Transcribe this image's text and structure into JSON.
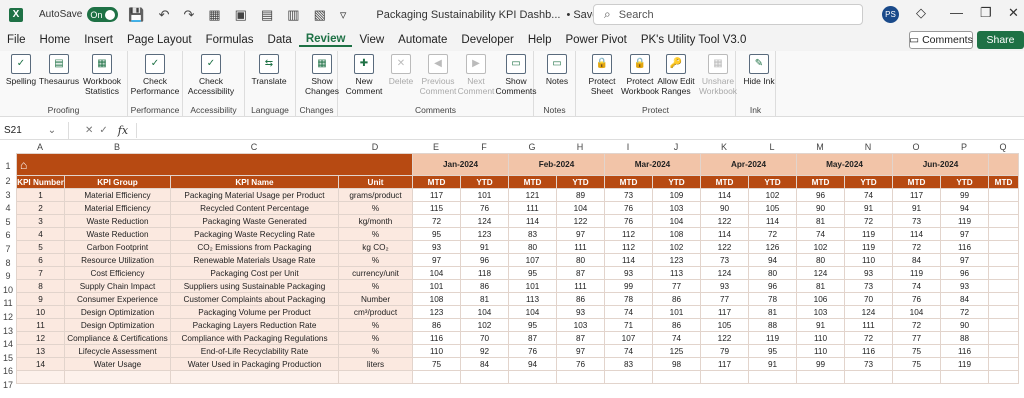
{
  "titlebar": {
    "autosave_label": "AutoSave",
    "autosave_state": "On",
    "doc_title": "Packaging Sustainability KPI Dashb...",
    "saved_status": "• Saved",
    "search_placeholder": "Search",
    "user_initials": "PS"
  },
  "menu": [
    "File",
    "Home",
    "Insert",
    "Page Layout",
    "Formulas",
    "Data",
    "Review",
    "View",
    "Automate",
    "Developer",
    "Help",
    "Power Pivot",
    "PK's Utility Tool V3.0"
  ],
  "menu_active": "Review",
  "buttons": {
    "comments": "Comments",
    "share": "Share"
  },
  "ribbon": {
    "groups": [
      {
        "label": "Proofing",
        "buttons": [
          "Spelling",
          "Thesaurus",
          "Workbook Statistics"
        ]
      },
      {
        "label": "Performance",
        "buttons": [
          "Check Performance"
        ]
      },
      {
        "label": "Accessibility",
        "buttons": [
          "Check Accessibility"
        ]
      },
      {
        "label": "Language",
        "buttons": [
          "Translate"
        ]
      },
      {
        "label": "Changes",
        "buttons": [
          "Show Changes"
        ]
      },
      {
        "label": "Comments",
        "buttons": [
          "New Comment",
          "Delete",
          "Previous Comment",
          "Next Comment",
          "Show Comments"
        ]
      },
      {
        "label": "Notes",
        "buttons": [
          "Notes"
        ]
      },
      {
        "label": "Protect",
        "buttons": [
          "Protect Sheet",
          "Protect Workbook",
          "Allow Edit Ranges",
          "Unshare Workbook"
        ]
      },
      {
        "label": "Ink",
        "buttons": [
          "Hide Ink"
        ]
      }
    ]
  },
  "namebox": "S21",
  "columns": [
    "A",
    "B",
    "C",
    "D",
    "E",
    "F",
    "G",
    "H",
    "I",
    "J",
    "K",
    "L",
    "M",
    "N",
    "O",
    "P",
    "Q"
  ],
  "rows": [
    "1",
    "2",
    "3",
    "4",
    "5",
    "6",
    "7",
    "8",
    "9",
    "10",
    "11",
    "12",
    "13",
    "14",
    "15",
    "16",
    "17"
  ],
  "months": [
    "Jan-2024",
    "Feb-2024",
    "Mar-2024",
    "Apr-2024",
    "May-2024",
    "Jun-2024"
  ],
  "headers": {
    "kpi_number": "KPI Number",
    "kpi_group": "KPI Group",
    "kpi_name": "KPI Name",
    "unit": "Unit",
    "mtd": "MTD",
    "ytd": "YTD"
  },
  "kpis": [
    {
      "n": "1",
      "group": "Material Efficiency",
      "name": "Packaging Material Usage per Product",
      "unit": "grams/product",
      "v": [
        "117",
        "101",
        "121",
        "89",
        "73",
        "109",
        "114",
        "102",
        "96",
        "74",
        "117",
        "99"
      ]
    },
    {
      "n": "2",
      "group": "Material Efficiency",
      "name": "Recycled Content Percentage",
      "unit": "%",
      "v": [
        "115",
        "76",
        "111",
        "104",
        "76",
        "103",
        "90",
        "105",
        "90",
        "91",
        "91",
        "94"
      ]
    },
    {
      "n": "3",
      "group": "Waste Reduction",
      "name": "Packaging Waste Generated",
      "unit": "kg/month",
      "v": [
        "72",
        "124",
        "114",
        "122",
        "76",
        "104",
        "122",
        "114",
        "81",
        "72",
        "73",
        "119"
      ]
    },
    {
      "n": "4",
      "group": "Waste Reduction",
      "name": "Packaging Waste Recycling Rate",
      "unit": "%",
      "v": [
        "95",
        "123",
        "83",
        "97",
        "112",
        "108",
        "114",
        "72",
        "74",
        "119",
        "114",
        "97"
      ]
    },
    {
      "n": "5",
      "group": "Carbon Footprint",
      "name": "CO₂ Emissions from Packaging",
      "unit": "kg CO₂",
      "v": [
        "93",
        "91",
        "80",
        "111",
        "112",
        "102",
        "122",
        "126",
        "102",
        "119",
        "72",
        "116"
      ]
    },
    {
      "n": "6",
      "group": "Resource Utilization",
      "name": "Renewable Materials Usage Rate",
      "unit": "%",
      "v": [
        "97",
        "96",
        "107",
        "80",
        "114",
        "123",
        "73",
        "94",
        "80",
        "110",
        "84",
        "97"
      ]
    },
    {
      "n": "7",
      "group": "Cost Efficiency",
      "name": "Packaging Cost per Unit",
      "unit": "currency/unit",
      "v": [
        "104",
        "118",
        "95",
        "87",
        "93",
        "113",
        "124",
        "80",
        "124",
        "93",
        "119",
        "96"
      ]
    },
    {
      "n": "8",
      "group": "Supply Chain Impact",
      "name": "Suppliers using Sustainable Packaging",
      "unit": "%",
      "v": [
        "101",
        "86",
        "101",
        "111",
        "99",
        "77",
        "93",
        "96",
        "81",
        "73",
        "74",
        "93"
      ]
    },
    {
      "n": "9",
      "group": "Consumer Experience",
      "name": "Customer Complaints about Packaging",
      "unit": "Number",
      "v": [
        "108",
        "81",
        "113",
        "86",
        "78",
        "86",
        "77",
        "78",
        "106",
        "70",
        "76",
        "84"
      ]
    },
    {
      "n": "10",
      "group": "Design Optimization",
      "name": "Packaging Volume per Product",
      "unit": "cm³/product",
      "v": [
        "123",
        "104",
        "104",
        "93",
        "74",
        "101",
        "117",
        "81",
        "103",
        "124",
        "104",
        "72"
      ]
    },
    {
      "n": "11",
      "group": "Design Optimization",
      "name": "Packaging Layers Reduction Rate",
      "unit": "%",
      "v": [
        "86",
        "102",
        "95",
        "103",
        "71",
        "86",
        "105",
        "88",
        "91",
        "111",
        "72",
        "90"
      ]
    },
    {
      "n": "12",
      "group": "Compliance & Certifications",
      "name": "Compliance with Packaging Regulations",
      "unit": "%",
      "v": [
        "116",
        "70",
        "87",
        "87",
        "107",
        "74",
        "122",
        "119",
        "110",
        "72",
        "77",
        "88"
      ]
    },
    {
      "n": "13",
      "group": "Lifecycle Assessment",
      "name": "End-of-Life Recyclability Rate",
      "unit": "%",
      "v": [
        "110",
        "92",
        "76",
        "97",
        "74",
        "125",
        "79",
        "95",
        "110",
        "116",
        "75",
        "116"
      ]
    },
    {
      "n": "14",
      "group": "Water Usage",
      "name": "Water Used in Packaging Production",
      "unit": "liters",
      "v": [
        "75",
        "84",
        "94",
        "76",
        "83",
        "98",
        "117",
        "91",
        "99",
        "73",
        "75",
        "119"
      ]
    }
  ]
}
